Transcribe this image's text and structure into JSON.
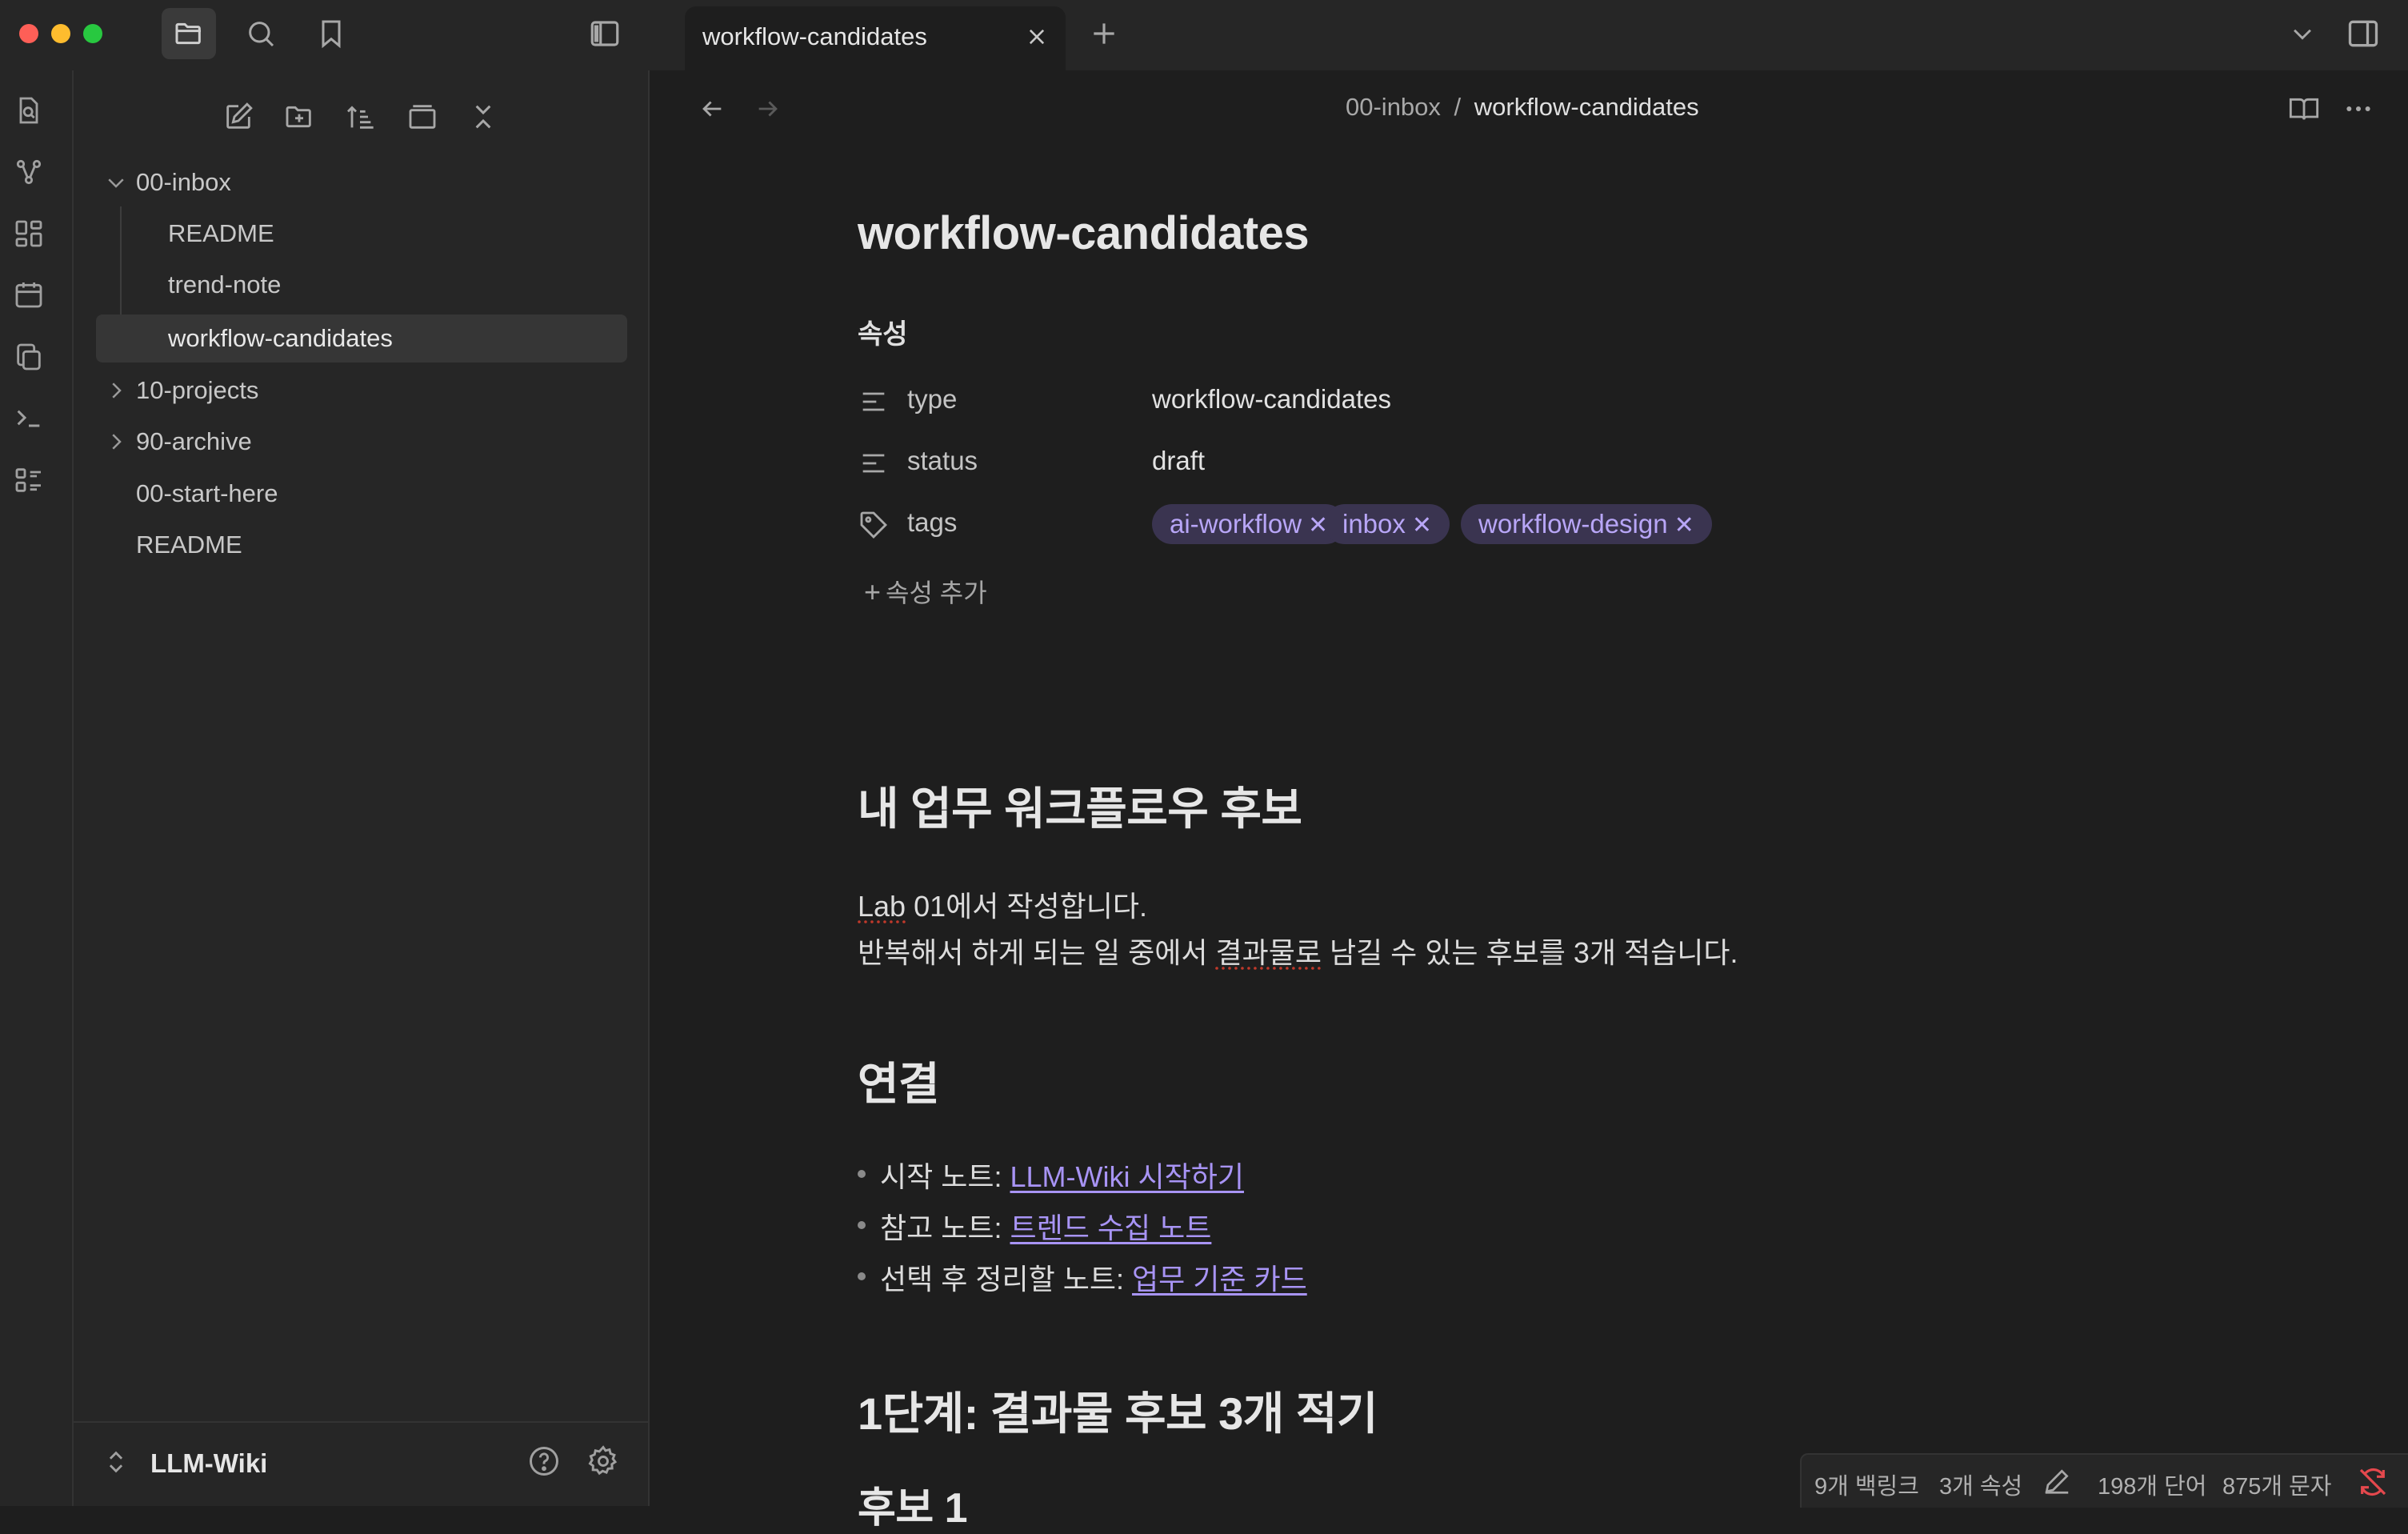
{
  "titlebar": {
    "tab_label": "workflow-candidates"
  },
  "colors": {
    "accent": "#a894f5",
    "tag_bg": "#3a3450",
    "traffic_red": "#fe5f57",
    "traffic_yellow": "#febc2e",
    "traffic_green": "#28c840",
    "sync_error": "#e5484d"
  },
  "sidebar": {
    "tree": [
      {
        "label": "00-inbox",
        "expanded": true
      },
      {
        "label": "README"
      },
      {
        "label": "trend-note"
      },
      {
        "label": "workflow-candidates",
        "selected": true
      },
      {
        "label": "10-projects",
        "expanded": false
      },
      {
        "label": "90-archive",
        "expanded": false
      },
      {
        "label": "00-start-here"
      },
      {
        "label": "README"
      }
    ],
    "vault_name": "LLM-Wiki"
  },
  "header": {
    "breadcrumb_parent": "00-inbox",
    "breadcrumb_sep": "/",
    "breadcrumb_current": "workflow-candidates"
  },
  "note": {
    "title": "workflow-candidates",
    "properties_heading": "속성",
    "properties": [
      {
        "key": "type",
        "value": "workflow-candidates",
        "icon": "text-lines-icon"
      },
      {
        "key": "status",
        "value": "draft",
        "icon": "text-lines-icon"
      },
      {
        "key": "tags",
        "icon": "tag-icon",
        "tags": [
          "ai-workflow",
          "inbox",
          "workflow-design"
        ]
      }
    ],
    "add_property": "속성 추가",
    "h_section1": "내 업무 워크플로우 후보",
    "para1_a": "Lab",
    "para1_b": " 01에서 작성합니다.",
    "para2_a": "반복해서 하게 되는 일 중에서 ",
    "para2_b": "결과물로",
    "para2_c": " 남길 수 있는 후보를 3개 적습니다.",
    "h_section2": "연결",
    "links": [
      {
        "prefix": "시작 노트: ",
        "link": "LLM-Wiki 시작하기"
      },
      {
        "prefix": "참고 노트: ",
        "link": "트렌드 수집 노트"
      },
      {
        "prefix": "선택 후 정리할 노트: ",
        "link": "업무 기준 카드"
      }
    ],
    "h_section3": "1단계: 결과물 후보 3개 적기",
    "h_section4_partial": "후보 1"
  },
  "statusbar": {
    "backlinks": "9개 백링크",
    "properties": "3개 속성",
    "words": "198개 단어",
    "chars": "875개 문자"
  }
}
